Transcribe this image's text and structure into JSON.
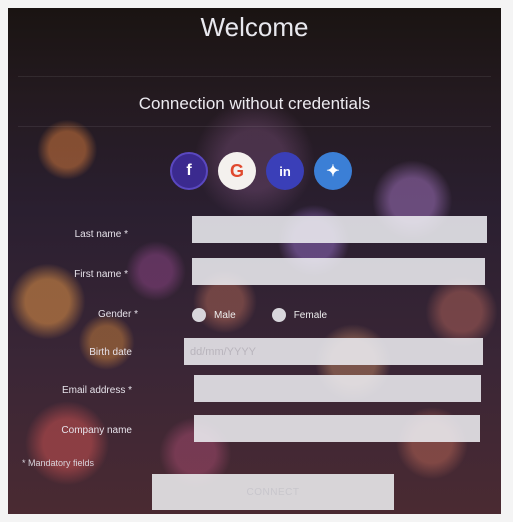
{
  "header": {
    "title": "Welcome",
    "subtitle": "Connection without credentials"
  },
  "social": [
    {
      "name": "facebook",
      "glyph": "f",
      "color": "#3b2a8f"
    },
    {
      "name": "google",
      "glyph": "G",
      "color": "#f4f1ee"
    },
    {
      "name": "linkedin",
      "glyph": "in",
      "color": "#3a3fb8"
    },
    {
      "name": "twitter",
      "glyph": "✦",
      "color": "#3b7fd6"
    }
  ],
  "form": {
    "last_name_label": "Last name *",
    "first_name_label": "First name *",
    "gender_label": "Gender *",
    "gender_male": "Male",
    "gender_female": "Female",
    "birth_date_label": "Birth date",
    "birth_date_placeholder": "dd/mm/YYYY",
    "email_label": "Email address *",
    "company_label": "Company name",
    "mandatory_note": "* Mandatory fields",
    "connect_label": "CONNECT"
  }
}
